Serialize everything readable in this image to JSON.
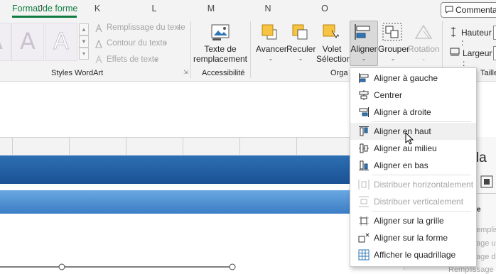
{
  "tab": {
    "active": "Format de forme"
  },
  "comment_button": {
    "label": "Commentaires"
  },
  "wordart": {
    "letter": "A",
    "menu": [
      "Remplissage du texte",
      "Contour du texte",
      "Effets de texte"
    ],
    "group_label": "Styles WordArt"
  },
  "accessibility": {
    "button_line1": "Texte de",
    "button_line2": "remplacement",
    "group_label": "Accessibilité"
  },
  "arrange": {
    "avancer": "Avancer",
    "reculer": "Reculer",
    "volet_line1": "Volet",
    "volet_line2": "Sélection",
    "aligner": "Aligner",
    "grouper": "Grouper",
    "rotation": "Rotation",
    "group_label_partial": "Orga"
  },
  "size": {
    "hauteur": "Hauteur :",
    "largeur": "Largeur :",
    "group_label_partial": "Taille"
  },
  "columns": [
    "J",
    "K",
    "L",
    "M",
    "N",
    "O"
  ],
  "align_menu": {
    "items": [
      {
        "label": "Aligner à gauche",
        "icon": "align-left-icon",
        "enabled": true
      },
      {
        "label": "Centrer",
        "icon": "align-center-icon",
        "enabled": true
      },
      {
        "label": "Aligner à droite",
        "icon": "align-right-icon",
        "enabled": true
      },
      {
        "label": "Aligner en haut",
        "icon": "align-top-icon",
        "enabled": true,
        "hover": true
      },
      {
        "label": "Aligner au milieu",
        "icon": "align-middle-icon",
        "enabled": true
      },
      {
        "label": "Aligner en bas",
        "icon": "align-bottom-icon",
        "enabled": true
      },
      {
        "label": "Distribuer horizontalement",
        "icon": "distribute-horizontal-icon",
        "enabled": false
      },
      {
        "label": "Distribuer verticalement",
        "icon": "distribute-vertical-icon",
        "enabled": false
      },
      {
        "label": "Aligner sur la grille",
        "icon": "snap-grid-icon",
        "enabled": true
      },
      {
        "label": "Aligner sur la forme",
        "icon": "snap-shape-icon",
        "enabled": true
      },
      {
        "label": "Afficher le quadrillage",
        "icon": "gridlines-icon",
        "enabled": true
      }
    ]
  },
  "side_pane": {
    "heading_partial": "e la",
    "items_partial": [
      "emplis",
      "age u",
      "age d",
      "Remplissage"
    ]
  },
  "colors": {
    "accent": "#107c41",
    "band_dark": "#1f5c9e",
    "band_light": "#5f9fdc"
  }
}
